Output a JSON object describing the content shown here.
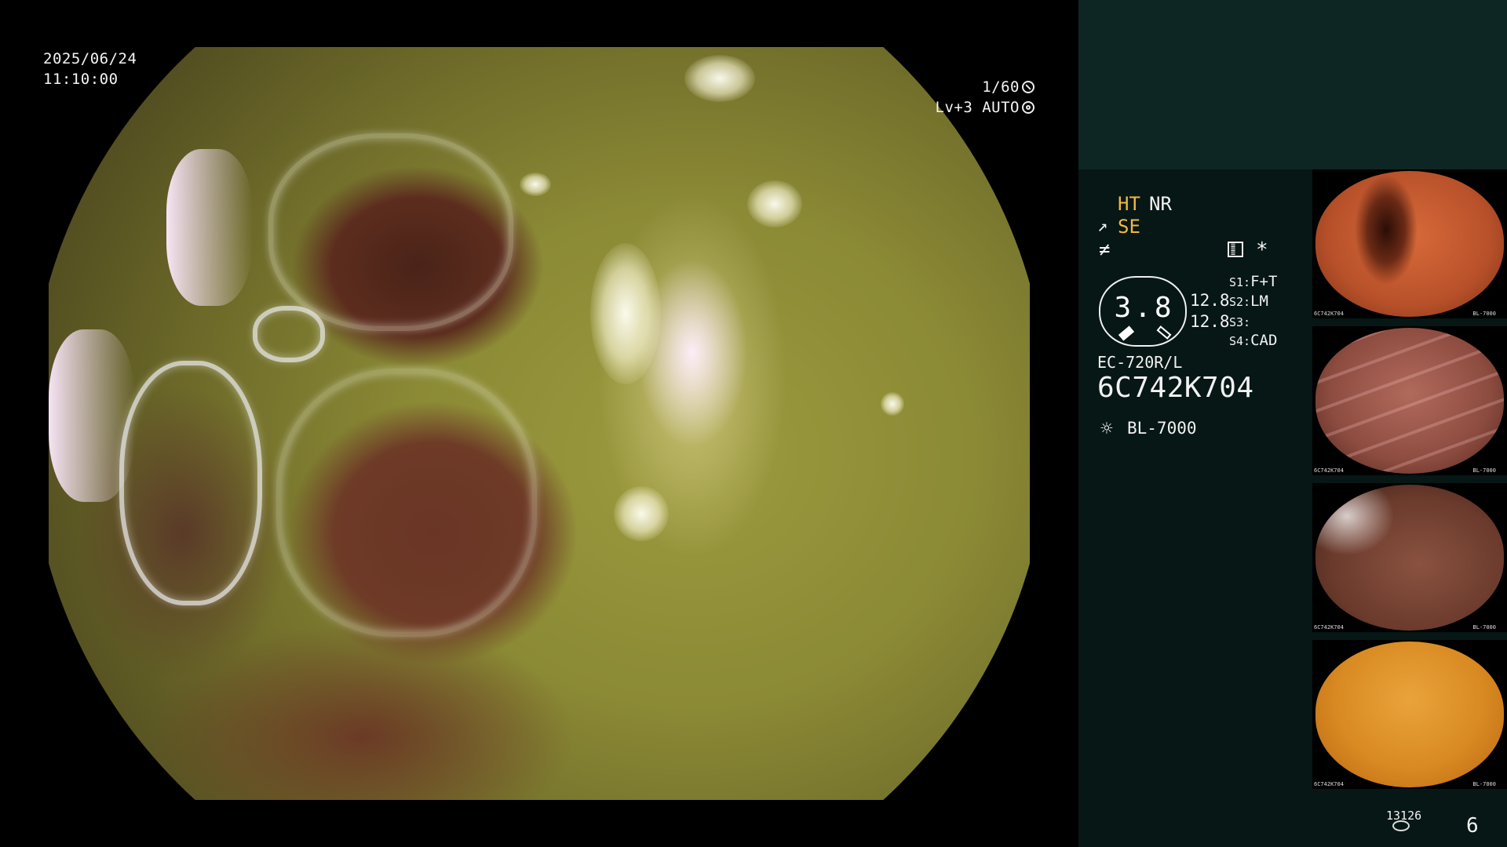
{
  "overlay": {
    "date": "2025/06/24",
    "time": "11:10:00",
    "shutter": "1/60",
    "level": "Lv+3 AUTO"
  },
  "panel": {
    "mode_ht": "HT",
    "mode_nr": "NR",
    "mode_se": "SE",
    "gauge_value": "3.8",
    "value_1": "12.8",
    "value_2": "12.8",
    "settings": [
      {
        "key": "S1:",
        "value": "F+T"
      },
      {
        "key": "S2:",
        "value": "LM"
      },
      {
        "key": "S3:",
        "value": ""
      },
      {
        "key": "S4:",
        "value": "CAD"
      }
    ],
    "scope_model": "EC-720R/L",
    "serial": "6C742K704",
    "light_source": "BL-7000",
    "image_counter": "13126",
    "page_number": "6"
  },
  "thumbnails": [
    {
      "label": "6C742K704",
      "light": "BL-7000"
    },
    {
      "label": "6C742K704",
      "light": "BL-7000"
    },
    {
      "label": "6C742K704",
      "light": "BL-7000"
    },
    {
      "label": "6C742K704",
      "light": "BL-7000"
    }
  ],
  "colors": {
    "panel_top": "#0d2624",
    "panel": "#061715",
    "accent_yellow": "#f5b73c"
  },
  "icons": {
    "shutter": "aperture-icon",
    "auto": "iris-icon",
    "se": "scope-icon",
    "freeze": "slash-icon",
    "record": "document-icon",
    "light": "sun-icon",
    "storage": "disk-icon"
  }
}
